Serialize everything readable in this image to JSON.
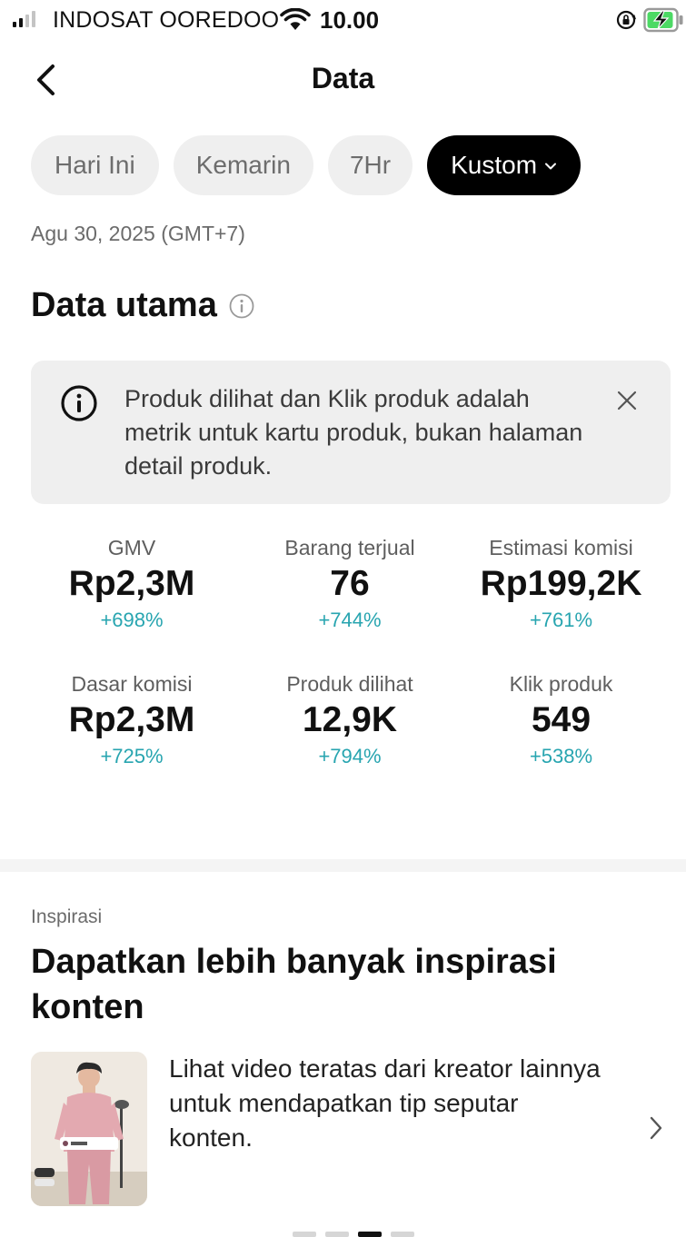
{
  "status_bar": {
    "carrier": "INDOSAT OOREDOO",
    "time": "10.00"
  },
  "header": {
    "title": "Data"
  },
  "filters": {
    "chips": [
      {
        "label": "Hari Ini",
        "active": false
      },
      {
        "label": "Kemarin",
        "active": false
      },
      {
        "label": "7Hr",
        "active": false
      },
      {
        "label": "Kustom",
        "active": true
      }
    ]
  },
  "date_label": "Agu 30, 2025 (GMT+7)",
  "main_data": {
    "title": "Data utama",
    "info_banner": "Produk dilihat dan Klik produk adalah metrik untuk kartu produk, bukan halaman detail produk.",
    "metrics": [
      {
        "label": "GMV",
        "value": "Rp2,3M",
        "change": "+698%"
      },
      {
        "label": "Barang terjual",
        "value": "76",
        "change": "+744%"
      },
      {
        "label": "Estimasi komisi",
        "value": "Rp199,2K",
        "change": "+761%"
      },
      {
        "label": "Dasar komisi",
        "value": "Rp2,3M",
        "change": "+725%"
      },
      {
        "label": "Produk dilihat",
        "value": "12,9K",
        "change": "+794%"
      },
      {
        "label": "Klik produk",
        "value": "549",
        "change": "+538%"
      }
    ]
  },
  "inspiration": {
    "caption": "Inspirasi",
    "title": "Dapatkan lebih banyak inspirasi konten",
    "card_text": "Lihat video teratas dari kreator lainnya untuk mendapatkan tip seputar konten."
  },
  "colors": {
    "accent_positive": "#28a5b0",
    "chip_active_bg": "#000000",
    "chip_bg": "#efefef"
  },
  "pager": {
    "count": 4,
    "active_index": 2
  }
}
